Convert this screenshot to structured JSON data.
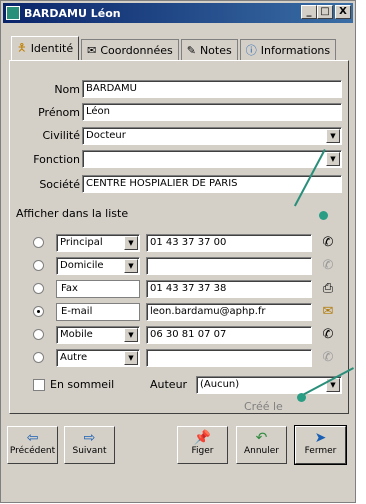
{
  "window": {
    "title": "BARDAMU Léon",
    "controls": {
      "minimize": "_",
      "maximize": "□",
      "close": "X"
    }
  },
  "tabs": [
    {
      "label": "Identité",
      "icon": "person-icon"
    },
    {
      "label": "Coordonnées",
      "icon": "envelope-icon"
    },
    {
      "label": "Notes",
      "icon": "pencil-icon"
    },
    {
      "label": "Informations",
      "icon": "info-icon"
    }
  ],
  "identity": {
    "nom_label": "Nom",
    "nom_value": "BARDAMU",
    "prenom_label": "Prénom",
    "prenom_value": "Léon",
    "civilite_label": "Civilité",
    "civilite_value": "Docteur",
    "fonction_label": "Fonction",
    "fonction_value": "",
    "societe_label": "Société",
    "societe_value": "CENTRE HOSPIALIER DE PARIS"
  },
  "list_section": {
    "title": "Afficher dans la liste"
  },
  "contacts": [
    {
      "type": "Principal",
      "value": "01 43 37 37 00",
      "selected": false,
      "icon": "phone-icon"
    },
    {
      "type": "Domicile",
      "value": "",
      "selected": false,
      "icon": "phone-icon"
    },
    {
      "type": "Fax",
      "value": "01 43 37 37 38",
      "selected": false,
      "icon": "fax-icon"
    },
    {
      "type": "E-mail",
      "value": "leon.bardamu@aphp.fr",
      "selected": true,
      "icon": "email-icon"
    },
    {
      "type": "Mobile",
      "value": "06 30 81 07 07",
      "selected": false,
      "icon": "phone-icon"
    },
    {
      "type": "Autre",
      "value": "",
      "selected": false,
      "icon": "phone-icon"
    }
  ],
  "footer_fields": {
    "en_sommeil_label": "En sommeil",
    "auteur_label": "Auteur",
    "auteur_value": "(Aucun)",
    "cree_le_label": "Créé le"
  },
  "buttons": {
    "precedent": "Précédent",
    "suivant": "Suivant",
    "figer": "Figer",
    "annuler": "Annuler",
    "fermer": "Fermer"
  },
  "colors": {
    "annotation": "#2a8f7a",
    "titlebar": "#0a246a"
  }
}
